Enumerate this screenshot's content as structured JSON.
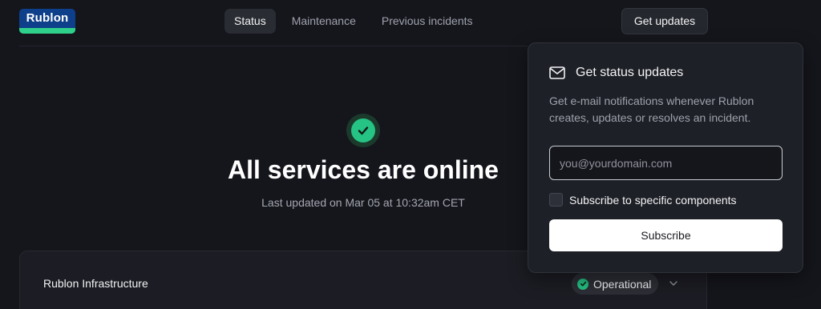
{
  "brand": {
    "logo_text": "Rublon"
  },
  "nav": {
    "tabs": [
      {
        "label": "Status",
        "active": true
      },
      {
        "label": "Maintenance",
        "active": false
      },
      {
        "label": "Previous incidents",
        "active": false
      }
    ],
    "get_updates_label": "Get updates"
  },
  "hero": {
    "icon": "check-circle-icon",
    "title": "All services are online",
    "last_updated": "Last updated on Mar 05 at 10:32am CET"
  },
  "components": [
    {
      "name": "Rublon Infrastructure",
      "status": "Operational",
      "status_color": "#25c384"
    }
  ],
  "popover": {
    "icon": "envelope-icon",
    "title": "Get status updates",
    "description": "Get e-mail notifications whenever Rublon creates, updates or resolves an incident.",
    "email_placeholder": "you@yourdomain.com",
    "email_value": "",
    "checkbox_label": "Subscribe to specific components",
    "checkbox_checked": false,
    "subscribe_label": "Subscribe"
  },
  "colors": {
    "background": "#15161c",
    "accent_green": "#25c384",
    "brand_blue": "#0e3f8a"
  }
}
